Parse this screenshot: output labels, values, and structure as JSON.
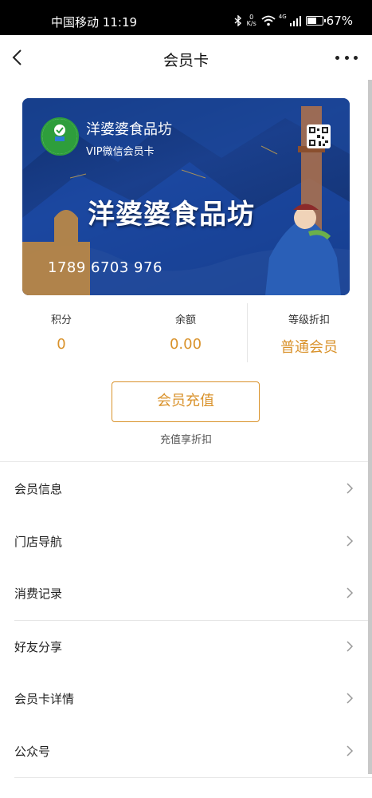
{
  "status_bar": {
    "carrier": "中国移动",
    "time": "11:19",
    "speed_top": "0",
    "speed_bottom": "K/s",
    "network": "4G",
    "battery": "67%",
    "battery_level": 0.67
  },
  "nav": {
    "title": "会员卡"
  },
  "card": {
    "shop_name": "洋婆婆食品坊",
    "subtitle": "VIP微信会员卡",
    "banner_text": "洋婆婆食品坊",
    "card_number": "1789 6703 976",
    "logo_text": "洋婆婆食品坊"
  },
  "stats": {
    "points_label": "积分",
    "points_value": "0",
    "balance_label": "余额",
    "balance_value": "0.00",
    "level_label": "等级折扣",
    "level_value": "普通会员"
  },
  "recharge": {
    "button": "会员充值",
    "hint": "充值享折扣"
  },
  "menu": [
    {
      "label": "会员信息"
    },
    {
      "label": "门店导航"
    },
    {
      "label": "消费记录"
    },
    {
      "label": "好友分享"
    },
    {
      "label": "会员卡详情"
    },
    {
      "label": "公众号"
    }
  ],
  "colors": {
    "accent": "#d9922b",
    "card_blue": "#1a3f8c"
  },
  "icons": [
    "back-arrow-icon",
    "more-icon",
    "qr-code-icon",
    "chevron-right-icon",
    "bluetooth-icon",
    "wifi-icon",
    "signal-icon",
    "battery-icon"
  ]
}
